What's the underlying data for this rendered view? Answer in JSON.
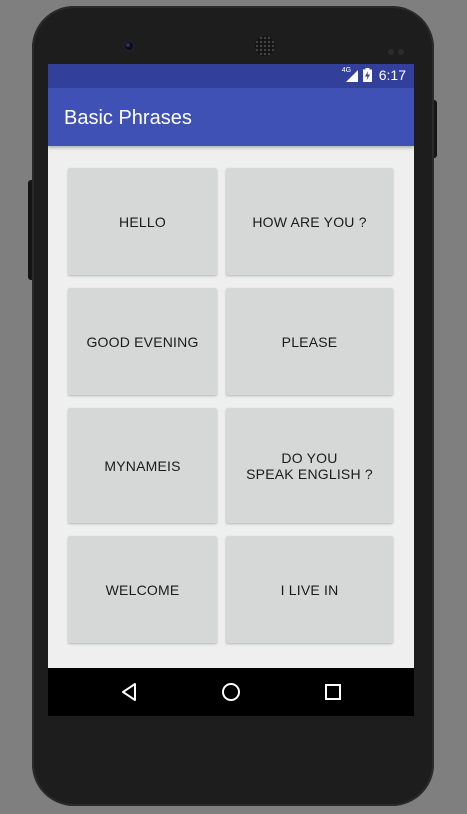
{
  "status_bar": {
    "network": "4G",
    "time": "6:17"
  },
  "app_bar": {
    "title": "Basic Phrases"
  },
  "phrases": [
    "HELLO",
    "HOW ARE YOU ?",
    "GOOD EVENING",
    "PLEASE",
    "MYNAMEIS",
    "DO YOU\nSPEAK ENGLISH ?",
    "WELCOME",
    "I LIVE IN"
  ],
  "navigation": {
    "back_icon": "triangle-back-icon",
    "home_icon": "circle-home-icon",
    "recents_icon": "square-recents-icon"
  },
  "colors": {
    "status_bar": "#33409b",
    "app_bar": "#3f51b5",
    "tile": "#d6d7d7",
    "screen_bg": "#efefef"
  }
}
